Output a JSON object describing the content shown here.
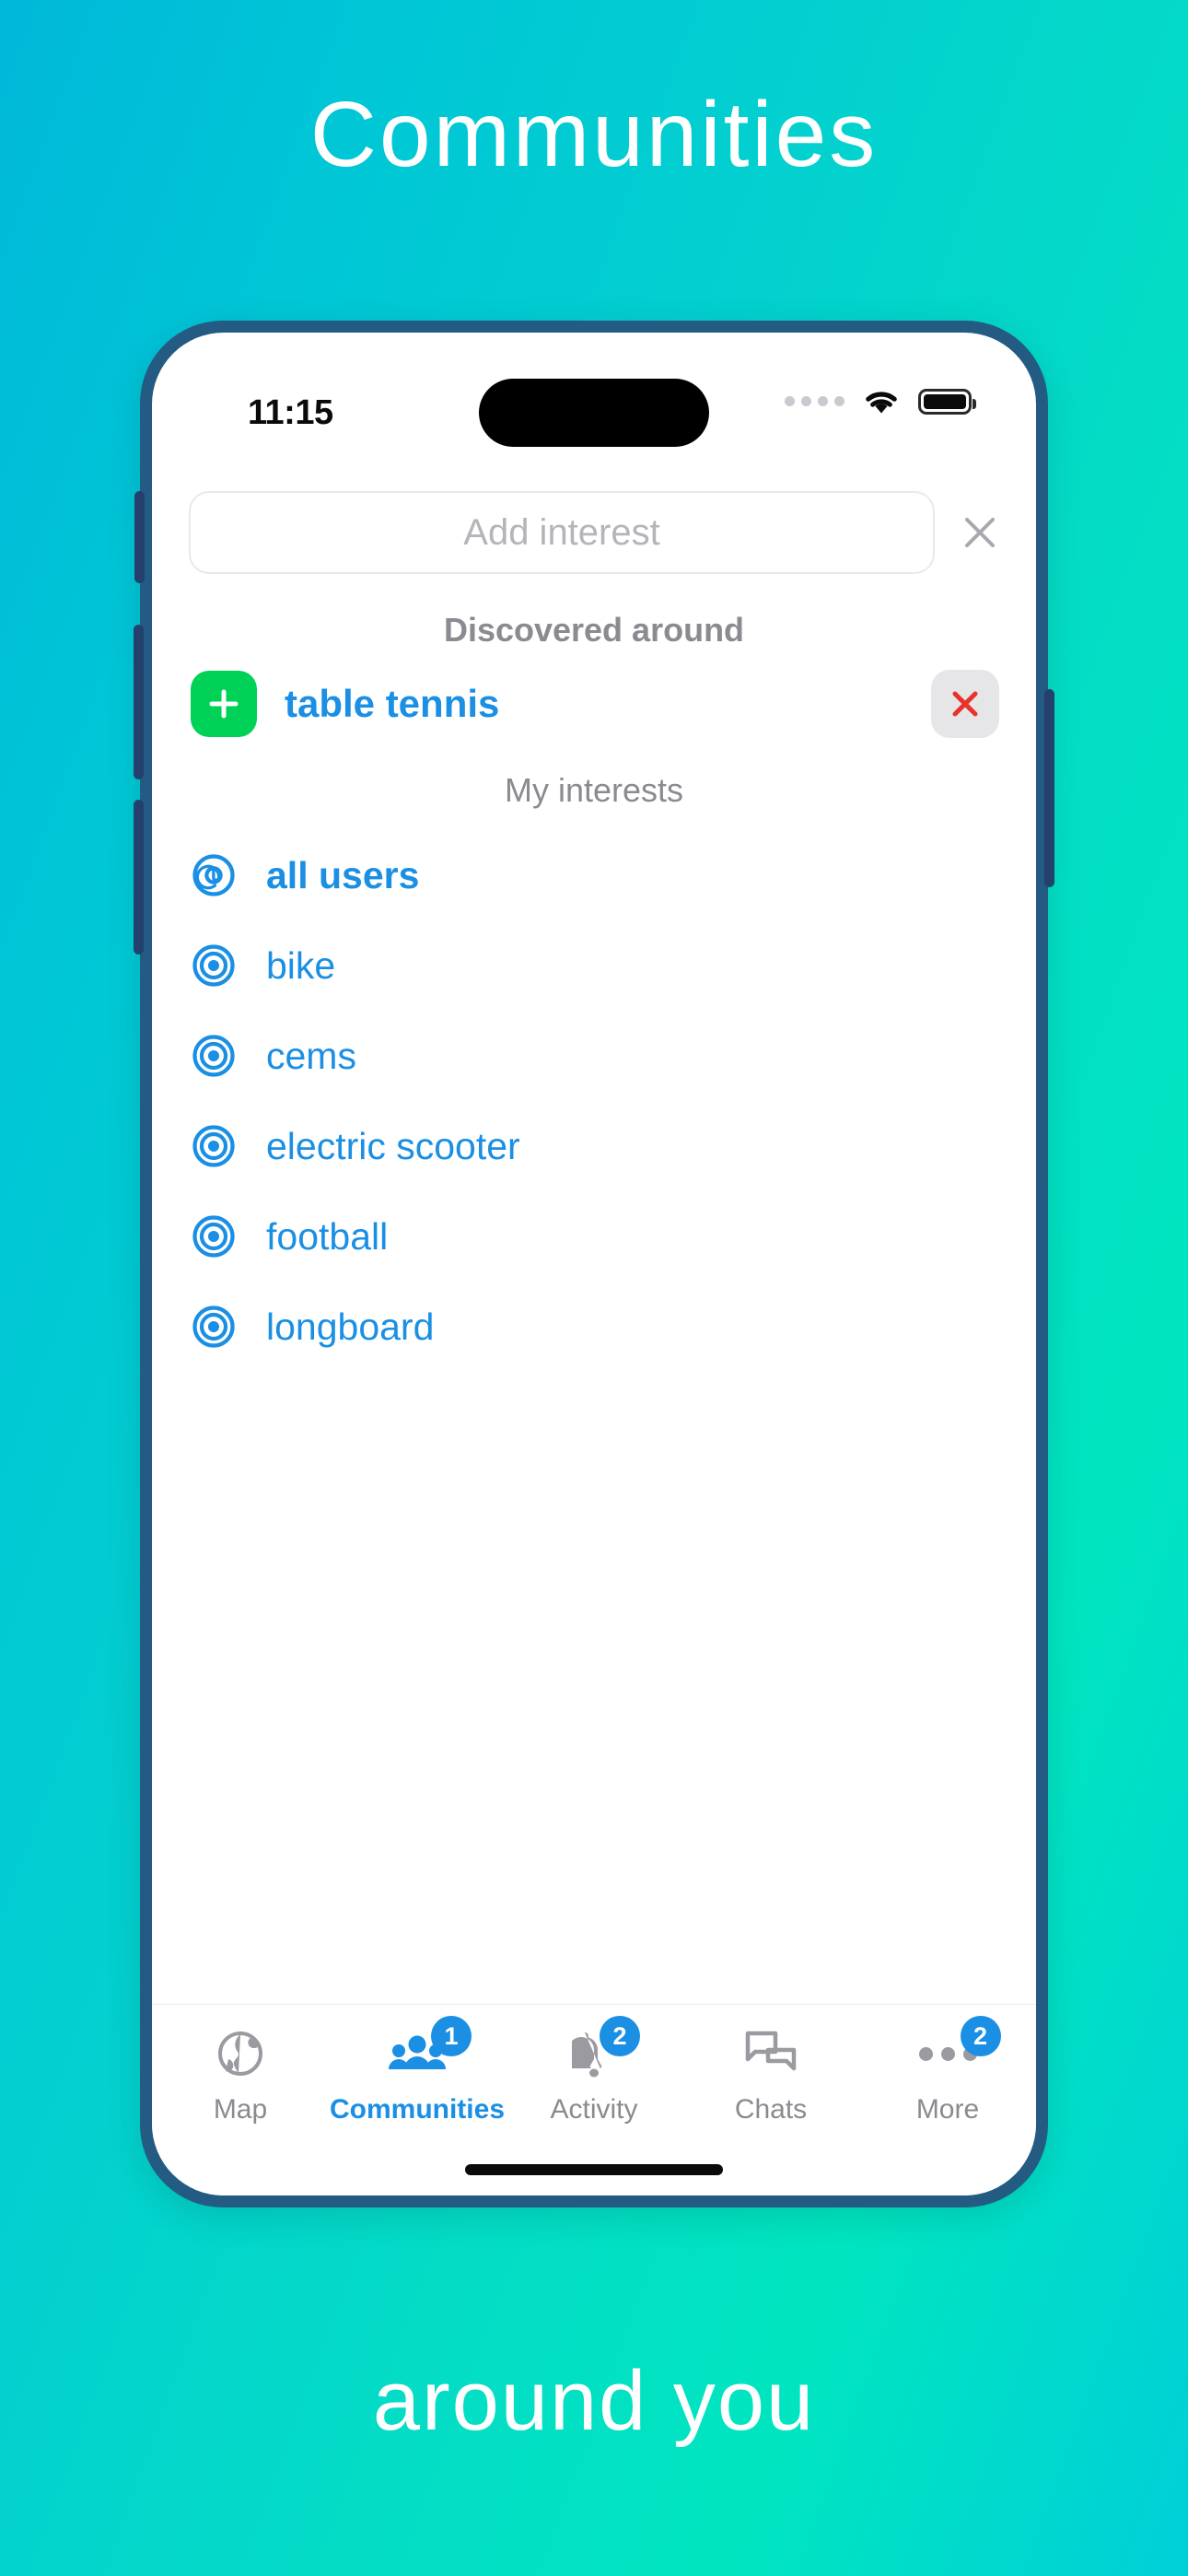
{
  "promo": {
    "title": "Communities",
    "caption": "around you"
  },
  "colors": {
    "accent_blue": "#1a8fe3",
    "green": "#00d157",
    "red": "#e8332a",
    "gray_text": "#8a8a90",
    "frame": "#235b82"
  },
  "status_bar": {
    "time": "11:15",
    "cellular_icon": "cellular-dots-icon",
    "wifi_icon": "wifi-icon",
    "battery_icon": "battery-full-icon"
  },
  "search": {
    "placeholder": "Add interest",
    "value": "",
    "clear_icon": "close-icon"
  },
  "sections": {
    "discovered_heading": "Discovered around",
    "my_interests_heading": "My interests"
  },
  "discovered": [
    {
      "label": "table tennis",
      "add_icon": "plus-icon",
      "remove_icon": "close-icon"
    }
  ],
  "interests": [
    {
      "label": "all users",
      "icon": "at-circle-icon",
      "bold": true
    },
    {
      "label": "bike",
      "icon": "at-circle-icon",
      "bold": false
    },
    {
      "label": "cems",
      "icon": "at-circle-icon",
      "bold": false
    },
    {
      "label": "electric scooter",
      "icon": "at-circle-icon",
      "bold": false
    },
    {
      "label": "football",
      "icon": "at-circle-icon",
      "bold": false
    },
    {
      "label": "longboard",
      "icon": "at-circle-icon",
      "bold": false
    }
  ],
  "tabbar": [
    {
      "label": "Map",
      "icon": "globe-icon",
      "badge": "",
      "active": false
    },
    {
      "label": "Communities",
      "icon": "people-icon",
      "badge": "1",
      "active": true
    },
    {
      "label": "Activity",
      "icon": "bell-icon",
      "badge": "2",
      "active": false
    },
    {
      "label": "Chats",
      "icon": "chat-icon",
      "badge": "",
      "active": false
    },
    {
      "label": "More",
      "icon": "dots-icon",
      "badge": "2",
      "active": false
    }
  ]
}
